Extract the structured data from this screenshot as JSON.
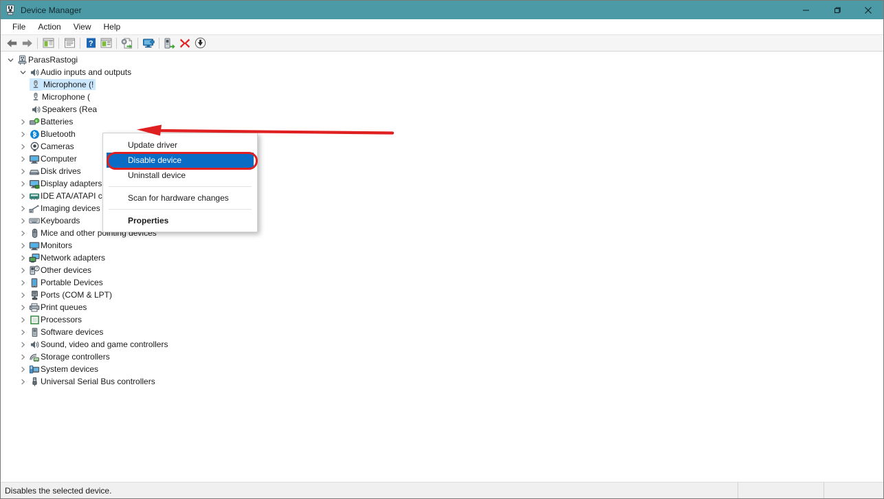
{
  "window": {
    "title": "Device Manager",
    "icon": "device-manager-icon",
    "titlebar_color": "#4d9aa7",
    "controls": {
      "minimize": "minimize-icon",
      "restore": "restore-icon",
      "close": "close-icon"
    }
  },
  "menubar": {
    "items": [
      {
        "label": "File"
      },
      {
        "label": "Action"
      },
      {
        "label": "View"
      },
      {
        "label": "Help"
      }
    ]
  },
  "toolbar": {
    "buttons": [
      {
        "name": "back-icon",
        "tooltip": "Back"
      },
      {
        "name": "forward-icon",
        "tooltip": "Forward"
      },
      {
        "name": "show-hide-console-tree-icon",
        "tooltip": "Show/Hide Console Tree"
      },
      {
        "name": "properties-icon",
        "tooltip": "Properties"
      },
      {
        "name": "help-icon",
        "tooltip": "Help"
      },
      {
        "name": "view-icon",
        "tooltip": "View"
      },
      {
        "name": "update-driver-icon",
        "tooltip": "Update driver"
      },
      {
        "name": "scan-hardware-changes-icon",
        "tooltip": "Scan for hardware changes"
      },
      {
        "name": "enable-device-icon",
        "tooltip": "Enable device"
      },
      {
        "name": "uninstall-device-icon",
        "tooltip": "Uninstall device"
      },
      {
        "name": "disable-device-icon",
        "tooltip": "Disable device"
      }
    ]
  },
  "tree": {
    "root": {
      "label": "ParasRastogi",
      "icon": "computer-node-icon",
      "expanded": true
    },
    "nodes": [
      {
        "label": "Audio inputs and outputs",
        "icon": "speaker-icon",
        "level": 1,
        "expanded": true,
        "selected": false
      },
      {
        "label": "Microphone (!",
        "icon": "microphone-icon",
        "level": 2,
        "expanded": null,
        "selected": true
      },
      {
        "label": "Microphone (",
        "icon": "microphone-icon",
        "level": 2,
        "expanded": null,
        "selected": false
      },
      {
        "label": "Speakers (Rea",
        "icon": "speaker-icon",
        "level": 2,
        "expanded": null,
        "selected": false
      },
      {
        "label": "Batteries",
        "icon": "battery-icon",
        "level": 1,
        "expanded": false,
        "selected": false
      },
      {
        "label": "Bluetooth",
        "icon": "bluetooth-icon",
        "level": 1,
        "expanded": false,
        "selected": false
      },
      {
        "label": "Cameras",
        "icon": "camera-icon",
        "level": 1,
        "expanded": false,
        "selected": false
      },
      {
        "label": "Computer",
        "icon": "computer-icon",
        "level": 1,
        "expanded": false,
        "selected": false
      },
      {
        "label": "Disk drives",
        "icon": "disk-drive-icon",
        "level": 1,
        "expanded": false,
        "selected": false
      },
      {
        "label": "Display adapters",
        "icon": "display-adapter-icon",
        "level": 1,
        "expanded": false,
        "selected": false
      },
      {
        "label": "IDE ATA/ATAPI controllers",
        "icon": "ide-controller-icon",
        "level": 1,
        "expanded": false,
        "selected": false
      },
      {
        "label": "Imaging devices",
        "icon": "imaging-device-icon",
        "level": 1,
        "expanded": false,
        "selected": false
      },
      {
        "label": "Keyboards",
        "icon": "keyboard-icon",
        "level": 1,
        "expanded": false,
        "selected": false
      },
      {
        "label": "Mice and other pointing devices",
        "icon": "mouse-icon",
        "level": 1,
        "expanded": false,
        "selected": false
      },
      {
        "label": "Monitors",
        "icon": "monitor-icon",
        "level": 1,
        "expanded": false,
        "selected": false
      },
      {
        "label": "Network adapters",
        "icon": "network-adapter-icon",
        "level": 1,
        "expanded": false,
        "selected": false
      },
      {
        "label": "Other devices",
        "icon": "other-device-icon",
        "level": 1,
        "expanded": false,
        "selected": false
      },
      {
        "label": "Portable Devices",
        "icon": "portable-device-icon",
        "level": 1,
        "expanded": false,
        "selected": false
      },
      {
        "label": "Ports (COM & LPT)",
        "icon": "port-icon",
        "level": 1,
        "expanded": false,
        "selected": false
      },
      {
        "label": "Print queues",
        "icon": "printer-icon",
        "level": 1,
        "expanded": false,
        "selected": false
      },
      {
        "label": "Processors",
        "icon": "processor-icon",
        "level": 1,
        "expanded": false,
        "selected": false
      },
      {
        "label": "Software devices",
        "icon": "software-device-icon",
        "level": 1,
        "expanded": false,
        "selected": false
      },
      {
        "label": "Sound, video and game controllers",
        "icon": "speaker-icon",
        "level": 1,
        "expanded": false,
        "selected": false
      },
      {
        "label": "Storage controllers",
        "icon": "storage-controller-icon",
        "level": 1,
        "expanded": false,
        "selected": false
      },
      {
        "label": "System devices",
        "icon": "system-device-icon",
        "level": 1,
        "expanded": false,
        "selected": false
      },
      {
        "label": "Universal Serial Bus controllers",
        "icon": "usb-icon",
        "level": 1,
        "expanded": false,
        "selected": false
      }
    ]
  },
  "context_menu": {
    "items": [
      {
        "label": "Update driver",
        "highlighted": false,
        "bold": false
      },
      {
        "label": "Disable device",
        "highlighted": true,
        "bold": false
      },
      {
        "label": "Uninstall device",
        "highlighted": false,
        "bold": false
      },
      {
        "label": "Scan for hardware changes",
        "highlighted": false,
        "bold": false
      },
      {
        "label": "Properties",
        "highlighted": false,
        "bold": true
      }
    ],
    "highlight_color": "#0a6cc4"
  },
  "annotations": {
    "arrow_color": "#e02020",
    "oval_color": "#e02020",
    "arrow_target": "Audio inputs and outputs",
    "oval_target": "Disable device"
  },
  "statusbar": {
    "message": "Disables the selected device.",
    "pane2": "",
    "pane3": ""
  }
}
